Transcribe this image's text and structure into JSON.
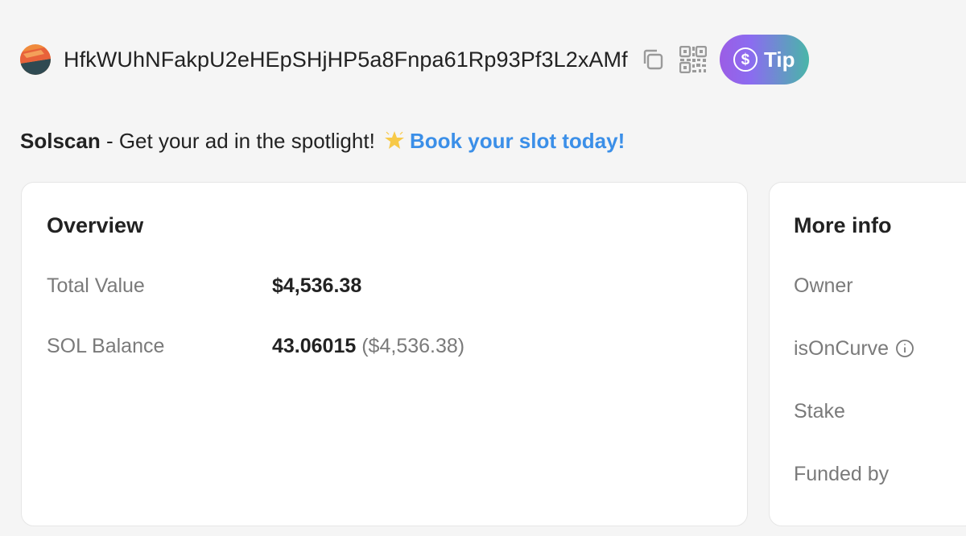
{
  "account": {
    "address": "HfkWUhNFakpU2eHEpSHjHP5a8Fnpa61Rp93Pf3L2xAMf",
    "avatar_icon": "wallet-avatar-icon",
    "copy_icon": "copy-icon",
    "qr_icon": "qr-code-icon",
    "tip": {
      "label": "Tip",
      "icon": "dollar-circle-icon",
      "symbol": "$"
    }
  },
  "ad": {
    "brand": "Solscan",
    "text": " - Get your ad in the spotlight! ",
    "star_icon": "glowing-star-icon",
    "link_label": "Book your slot today!"
  },
  "overview": {
    "title": "Overview",
    "rows": [
      {
        "label": "Total Value",
        "value": "$4,536.38",
        "sub": ""
      },
      {
        "label": "SOL Balance",
        "value": "43.06015",
        "sub": "($4,536.38)"
      }
    ]
  },
  "more_info": {
    "title": "More info",
    "rows": [
      {
        "label": "Owner"
      },
      {
        "label": "isOnCurve",
        "icon": "info-icon"
      },
      {
        "label": "Stake"
      },
      {
        "label": "Funded by"
      }
    ]
  },
  "colors": {
    "background": "#f5f5f5",
    "link": "#3b8fe8",
    "tip_gradient_start": "#9b5de5",
    "tip_gradient_end": "#49b6a8"
  }
}
